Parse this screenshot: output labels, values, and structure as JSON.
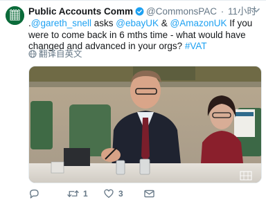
{
  "tweet": {
    "account_name": "Public Accounts Comm",
    "handle": "@CommonsPAC",
    "separator": "·",
    "timestamp": "11小时",
    "text": {
      "part1": ".",
      "mention1": "@gareth_snell",
      "part2": " asks ",
      "mention2": "@ebayUK",
      "part3": " & ",
      "mention3": "@AmazonUK",
      "part4": " If you were to come back in 6 mths time - what would have changed and advanced in your orgs? ",
      "hashtag": "#VAT"
    },
    "translate_label": "翻译自英文",
    "actions": {
      "retweet_count": "1",
      "like_count": "3"
    }
  },
  "icons": {
    "avatar": "portcullis-logo",
    "verified": "verified-badge-icon",
    "caret": "chevron-down-icon",
    "translate": "globe-icon",
    "reply": "reply-icon",
    "retweet": "retweet-icon",
    "like": "heart-icon",
    "dm": "envelope-icon"
  },
  "colors": {
    "link": "#1da1f2",
    "text": "#14171a",
    "muted": "#657786",
    "avatar_bg": "#0b6b3a"
  }
}
